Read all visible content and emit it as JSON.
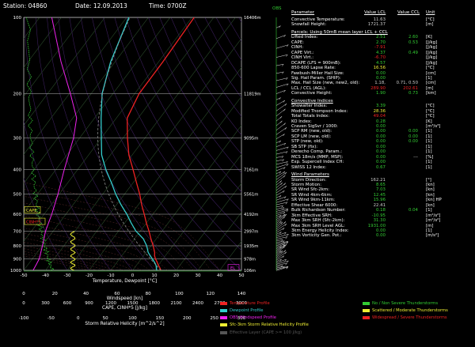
{
  "header": {
    "station": "Station: 04860",
    "date": "Date: 12.09.2013",
    "time": "Time: 0700Z"
  },
  "obs_label": "OBS",
  "params": {
    "col_headers": [
      "Parameter",
      "Value LCL",
      "Value CCL",
      "Unit"
    ],
    "sections": [
      {
        "title": null,
        "rows": [
          {
            "label": "Convective Temperature:",
            "v1": "11.63",
            "v2": "",
            "unit": "[°C]",
            "c1": "#ccc"
          },
          {
            "label": "Snowfall Height:",
            "v1": "1721.37",
            "v2": "",
            "unit": "[m]",
            "c1": "#ccc"
          }
        ]
      },
      {
        "title": "Parcels: Using 50mB mean layer LCL + CCL",
        "rows": [
          {
            "label": "Lifted Index:",
            "v1": "2.51",
            "v2": "2.60",
            "unit": "[K]",
            "c1": "#3c3",
            "c2": "#3c3"
          },
          {
            "label": "CAPE:",
            "v1": "2.70",
            "v2": "0.53",
            "unit": "[J/kg]",
            "c1": "#3c3",
            "c2": "#3c3"
          },
          {
            "label": "CINH:",
            "v1": "-7.91",
            "v2": "",
            "unit": "[J/kg]",
            "c1": "#e22"
          },
          {
            "label": "CAPE Virt.:",
            "v1": "4.37",
            "v2": "0.49",
            "unit": "[J/kg]",
            "c1": "#3c3",
            "c2": "#3c3"
          },
          {
            "label": "CINH Virt.:",
            "v1": "-6.70",
            "v2": "",
            "unit": "[J/kg]",
            "c1": "#e22"
          },
          {
            "label": "DCAPE (LFS = 900mB):",
            "v1": "4.57",
            "v2": "",
            "unit": "[J/kg]",
            "c1": "#3c3"
          },
          {
            "label": "850-600 Lapse Rate:",
            "v1": "16.56",
            "v2": "",
            "unit": "[°C]",
            "c1": "#ee3"
          },
          {
            "label": "Fawbush-Miller Hail Size:",
            "v1": "0.00",
            "v2": "",
            "unit": "[cm]",
            "c1": "#3c3"
          },
          {
            "label": "Sig. Hail Param. (SHIP):",
            "v1": "0.00",
            "v2": "",
            "unit": "[1]",
            "c1": "#3c3"
          },
          {
            "label": "Max. Hail Size (new, new2, old):",
            "v1": "1.18,",
            "v2": "0.71, 0.50",
            "unit": "[cm]",
            "c1": "#ccc",
            "c2": "#ccc"
          },
          {
            "label": "LCL / CCL (AGL):",
            "v1": "289.90",
            "v2": "202.61",
            "unit": "[m]",
            "c1": "#e22",
            "c2": "#e22"
          },
          {
            "label": "Convective Height:",
            "v1": "1.90",
            "v2": "0.73",
            "unit": "[km]",
            "c1": "#3c3",
            "c2": "#3c3"
          }
        ]
      },
      {
        "title": "Convective Indices",
        "rows": [
          {
            "label": "Showalter Index:",
            "v1": "3.39",
            "v2": "",
            "unit": "[°C]",
            "c1": "#3c3"
          },
          {
            "label": "Modified Thompson Index:",
            "v1": "28.36",
            "v2": "",
            "unit": "[°C]",
            "c1": "#ee3"
          },
          {
            "label": "Total Totals Index:",
            "v1": "49.04",
            "v2": "",
            "unit": "[°C]",
            "c1": "#e22"
          },
          {
            "label": "KO Index:",
            "v1": "0.28",
            "v2": "",
            "unit": "[K]",
            "c1": "#3c3"
          },
          {
            "label": "Craven SigSvr / 1000:",
            "v1": "0.00",
            "v2": "",
            "unit": "[m³/s³]",
            "c1": "#3c3"
          },
          {
            "label": "SCP RM (new, old):",
            "v1": "0.00",
            "v2": "0.00",
            "unit": "[1]",
            "c1": "#3c3",
            "c2": "#3c3"
          },
          {
            "label": "SCP LM (new, old):",
            "v1": "0.00",
            "v2": "0.00",
            "unit": "[1]",
            "c1": "#3c3",
            "c2": "#3c3"
          },
          {
            "label": "STP (new, old):",
            "v1": "0.00",
            "v2": "0.00",
            "unit": "[1]",
            "c1": "#3c3",
            "c2": "#3c3"
          },
          {
            "label": "SB STP (fix):",
            "v1": "0.00",
            "v2": "",
            "unit": "[1]",
            "c1": "#3c3"
          },
          {
            "label": "Derecho Comp. Param.:",
            "v1": "0.00",
            "v2": "",
            "unit": "[1]",
            "c1": "#3c3"
          },
          {
            "label": "MCS 18m/s (MMP, MSP):",
            "v1": "0.00",
            "v2": "---",
            "unit": "[%]",
            "c1": "#3c3",
            "c2": "#ccc"
          },
          {
            "label": "Exp. Supercell Index CH:",
            "v1": "0.00",
            "v2": "",
            "unit": "[1]",
            "c1": "#3c3"
          },
          {
            "label": "SWISS 12 Index:",
            "v1": "0.67",
            "v2": "",
            "unit": "[1]",
            "c1": "#3c3"
          }
        ]
      },
      {
        "title": "Wind Parameters",
        "rows": [
          {
            "label": "Storm Direction:",
            "v1": "162.21",
            "v2": "",
            "unit": "[°]",
            "c1": "#ccc"
          },
          {
            "label": "Storm Motion:",
            "v1": "8.65",
            "v2": "",
            "unit": "[kn]",
            "c1": "#3c3"
          },
          {
            "label": "SR Wind Sfc-2km:",
            "v1": "7.03",
            "v2": "",
            "unit": "[kn]",
            "c1": "#3c3"
          },
          {
            "label": "SR Wind 4km-6km:",
            "v1": "12.45",
            "v2": "",
            "unit": "[kn]",
            "c1": "#3c3"
          },
          {
            "label": "SR Wind 9km-11km:",
            "v1": "15.96",
            "v2": "",
            "unit": "[kn] HP",
            "c1": "#3c3"
          },
          {
            "label": "Effective Shear 6000:",
            "v1": "22.41",
            "v2": "",
            "unit": "[kn]",
            "c1": "#ccc"
          },
          {
            "label": "Bulk Richardson Number:",
            "v1": "0.18",
            "v2": "0.04",
            "unit": "[1]",
            "c1": "#3c3",
            "c2": "#3c3"
          },
          {
            "label": "3km Effective SRH:",
            "v1": "-10.95",
            "v2": "",
            "unit": "[m²/s²]",
            "c1": "#3c3"
          },
          {
            "label": "Max 3km SRH (Sfc-2km):",
            "v1": "31.30",
            "v2": "",
            "unit": "[m²/s²]",
            "c1": "#3c3"
          },
          {
            "label": "Max 3km SRH Level AGL:",
            "v1": "1931.00",
            "v2": "",
            "unit": "[m]",
            "c1": "#3c3"
          },
          {
            "label": "3km Energy Helicity Index:",
            "v1": "0.00",
            "v2": "",
            "unit": "[1]",
            "c1": "#3c3"
          },
          {
            "label": "3km Vorticity Gen. Pot.:",
            "v1": "0.00",
            "v2": "",
            "unit": "[m/s²]",
            "c1": "#3c3"
          }
        ]
      }
    ]
  },
  "legend": [
    {
      "label": "Temperature Profile",
      "color": "#e22"
    },
    {
      "label": "Dewpoint Profile",
      "color": "#3cc"
    },
    {
      "label": "OBS Windspeed Profile",
      "color": "#e2e"
    },
    {
      "label": "Sfc-3km Storm Relative Helicity Profile",
      "color": "#ee3"
    },
    {
      "label": "Effective Layer (CAPE >= 100 J/kg)",
      "color": "#555"
    },
    {
      "label": "No / Non Severe Thunderstorms",
      "color": "#3c3"
    },
    {
      "label": "Scattered / Moderate Thunderstorms",
      "color": "#ee3"
    },
    {
      "label": "Widespread / Severe Thunderstorms",
      "color": "#e22"
    }
  ],
  "chart_data": {
    "type": "line",
    "title": "",
    "pressure_levels": [
      100,
      200,
      300,
      400,
      500,
      600,
      700,
      800,
      900,
      1000
    ],
    "height_labels": [
      "16406m",
      "11819m",
      "9095m",
      "7161m",
      "5561m",
      "4192m",
      "2997m",
      "1935m",
      "978m",
      "106m"
    ],
    "temperature_axis": {
      "label": "Temperature, Dewpoint [°C]",
      "ticks": [
        -50,
        -40,
        -30,
        -20,
        -10,
        0,
        10,
        20,
        30,
        40,
        50
      ]
    },
    "windspeed_axis": {
      "label": "Windspeed [kn]",
      "ticks": [
        0,
        20,
        40,
        60,
        80,
        100,
        120,
        140
      ]
    },
    "cape_axis": {
      "label": "CAPE, CINH*5 [J/kg]",
      "ticks": [
        0,
        300,
        600,
        900,
        1200,
        1500,
        1800,
        2100,
        2400,
        2700,
        3000
      ]
    },
    "srh_axis": {
      "label": "Storm Relative Helicity [m^2/s^2]",
      "ticks": [
        -100,
        -50,
        0,
        50,
        100,
        150,
        200,
        250,
        300
      ]
    },
    "left_labels": [
      "CAPE",
      "CINH*5"
    ],
    "effective_layer_label": "EL",
    "series": [
      {
        "name": "Temperature Profile",
        "color": "#e22",
        "p": [
          1000,
          975,
          950,
          925,
          900,
          875,
          850,
          800,
          750,
          700,
          650,
          600,
          550,
          500,
          450,
          400,
          350,
          300,
          250,
          200,
          150,
          100
        ],
        "values": [
          13,
          11.5,
          9.8,
          8.2,
          6.5,
          5,
          4,
          1,
          -2.5,
          -6,
          -10,
          -14,
          -18.5,
          -23,
          -28.5,
          -34.5,
          -41.5,
          -48,
          -55,
          -58,
          -58,
          -59
        ]
      },
      {
        "name": "Dewpoint Profile",
        "color": "#3cc",
        "p": [
          1000,
          975,
          950,
          925,
          900,
          875,
          850,
          800,
          750,
          700,
          650,
          600,
          550,
          500,
          450,
          400,
          350,
          300,
          250,
          200,
          150,
          100
        ],
        "values": [
          11,
          10,
          8.7,
          7,
          5,
          3,
          1,
          -2,
          -6,
          -12,
          -17,
          -22,
          -28,
          -34,
          -40,
          -47,
          -54,
          -60,
          -67,
          -75,
          -82,
          -89
        ]
      },
      {
        "name": "OBS Windspeed Profile",
        "color": "#e2e",
        "p": [
          1000,
          950,
          900,
          850,
          800,
          700,
          600,
          500,
          400,
          300,
          250,
          200,
          150,
          100
        ],
        "values": [
          6,
          8,
          10,
          11,
          12,
          14,
          18,
          22,
          26,
          32,
          34,
          30,
          24,
          18
        ]
      }
    ]
  }
}
